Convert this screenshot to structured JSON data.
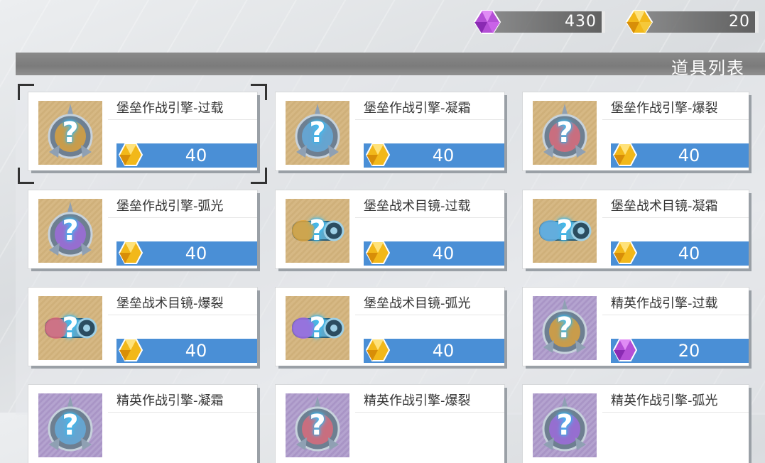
{
  "currency": [
    {
      "icon": "purple-crystal-icon",
      "amount": "430",
      "color": "#b44fd6"
    },
    {
      "icon": "gold-crystal-icon",
      "amount": "20",
      "color": "#f2b81a"
    }
  ],
  "panel": {
    "title": "道具列表"
  },
  "items": [
    {
      "name": "堡垒作战引擎-过载",
      "price": "40",
      "currency": "gold",
      "thumb": "engine",
      "accent": "#e0a43a",
      "selected": true
    },
    {
      "name": "堡垒作战引擎-凝霜",
      "price": "40",
      "currency": "gold",
      "thumb": "engine",
      "accent": "#64aee0"
    },
    {
      "name": "堡垒作战引擎-爆裂",
      "price": "40",
      "currency": "gold",
      "thumb": "engine",
      "accent": "#e06a7a"
    },
    {
      "name": "堡垒作战引擎-弧光",
      "price": "40",
      "currency": "gold",
      "thumb": "engine",
      "accent": "#a06ae0"
    },
    {
      "name": "堡垒战术目镜-过载",
      "price": "40",
      "currency": "gold",
      "thumb": "goggle",
      "accent": "#e0a43a"
    },
    {
      "name": "堡垒战术目镜-凝霜",
      "price": "40",
      "currency": "gold",
      "thumb": "goggle",
      "accent": "#64aee0"
    },
    {
      "name": "堡垒战术目镜-爆裂",
      "price": "40",
      "currency": "gold",
      "thumb": "goggle",
      "accent": "#e06a7a"
    },
    {
      "name": "堡垒战术目镜-弧光",
      "price": "40",
      "currency": "gold",
      "thumb": "goggle",
      "accent": "#a06ae0"
    },
    {
      "name": "精英作战引擎-过载",
      "price": "20",
      "currency": "purple",
      "thumb": "engine",
      "accent": "#e0a43a",
      "bg": "purple"
    },
    {
      "name": "精英作战引擎-凝霜",
      "price": "",
      "currency": "",
      "thumb": "engine",
      "accent": "#64aee0",
      "bg": "purple"
    },
    {
      "name": "精英作战引擎-爆裂",
      "price": "",
      "currency": "",
      "thumb": "engine",
      "accent": "#e06a7a",
      "bg": "purple"
    },
    {
      "name": "精英作战引擎-弧光",
      "price": "",
      "currency": "",
      "thumb": "engine",
      "accent": "#a06ae0",
      "bg": "purple"
    }
  ]
}
